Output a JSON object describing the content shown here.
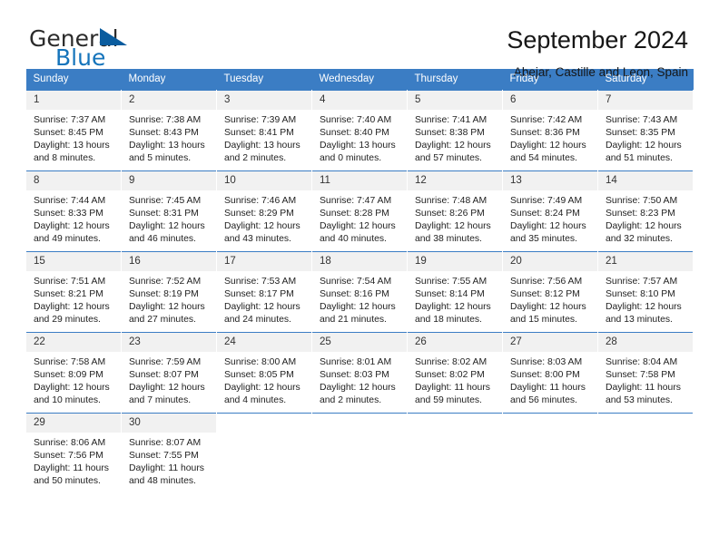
{
  "logo": {
    "word_one": "General",
    "word_two": "Blue",
    "triangle_icon": "triangle-icon"
  },
  "header": {
    "title": "September 2024",
    "subtitle": "Abejar, Castille and Leon, Spain"
  },
  "colors": {
    "header_blue": "#3b7dc4",
    "logo_blue": "#1574bb",
    "logo_triangle": "#0a5c9e",
    "daynum_band": "#f1f1f1",
    "text": "#222222"
  },
  "calendar": {
    "weekdays": [
      "Sunday",
      "Monday",
      "Tuesday",
      "Wednesday",
      "Thursday",
      "Friday",
      "Saturday"
    ],
    "labels": {
      "sunrise": "Sunrise:",
      "sunset": "Sunset:",
      "daylight": "Daylight:"
    },
    "weeks": [
      [
        {
          "day": "1",
          "sunrise": "Sunrise: 7:37 AM",
          "sunset": "Sunset: 8:45 PM",
          "daylight_1": "Daylight: 13 hours",
          "daylight_2": "and 8 minutes."
        },
        {
          "day": "2",
          "sunrise": "Sunrise: 7:38 AM",
          "sunset": "Sunset: 8:43 PM",
          "daylight_1": "Daylight: 13 hours",
          "daylight_2": "and 5 minutes."
        },
        {
          "day": "3",
          "sunrise": "Sunrise: 7:39 AM",
          "sunset": "Sunset: 8:41 PM",
          "daylight_1": "Daylight: 13 hours",
          "daylight_2": "and 2 minutes."
        },
        {
          "day": "4",
          "sunrise": "Sunrise: 7:40 AM",
          "sunset": "Sunset: 8:40 PM",
          "daylight_1": "Daylight: 13 hours",
          "daylight_2": "and 0 minutes."
        },
        {
          "day": "5",
          "sunrise": "Sunrise: 7:41 AM",
          "sunset": "Sunset: 8:38 PM",
          "daylight_1": "Daylight: 12 hours",
          "daylight_2": "and 57 minutes."
        },
        {
          "day": "6",
          "sunrise": "Sunrise: 7:42 AM",
          "sunset": "Sunset: 8:36 PM",
          "daylight_1": "Daylight: 12 hours",
          "daylight_2": "and 54 minutes."
        },
        {
          "day": "7",
          "sunrise": "Sunrise: 7:43 AM",
          "sunset": "Sunset: 8:35 PM",
          "daylight_1": "Daylight: 12 hours",
          "daylight_2": "and 51 minutes."
        }
      ],
      [
        {
          "day": "8",
          "sunrise": "Sunrise: 7:44 AM",
          "sunset": "Sunset: 8:33 PM",
          "daylight_1": "Daylight: 12 hours",
          "daylight_2": "and 49 minutes."
        },
        {
          "day": "9",
          "sunrise": "Sunrise: 7:45 AM",
          "sunset": "Sunset: 8:31 PM",
          "daylight_1": "Daylight: 12 hours",
          "daylight_2": "and 46 minutes."
        },
        {
          "day": "10",
          "sunrise": "Sunrise: 7:46 AM",
          "sunset": "Sunset: 8:29 PM",
          "daylight_1": "Daylight: 12 hours",
          "daylight_2": "and 43 minutes."
        },
        {
          "day": "11",
          "sunrise": "Sunrise: 7:47 AM",
          "sunset": "Sunset: 8:28 PM",
          "daylight_1": "Daylight: 12 hours",
          "daylight_2": "and 40 minutes."
        },
        {
          "day": "12",
          "sunrise": "Sunrise: 7:48 AM",
          "sunset": "Sunset: 8:26 PM",
          "daylight_1": "Daylight: 12 hours",
          "daylight_2": "and 38 minutes."
        },
        {
          "day": "13",
          "sunrise": "Sunrise: 7:49 AM",
          "sunset": "Sunset: 8:24 PM",
          "daylight_1": "Daylight: 12 hours",
          "daylight_2": "and 35 minutes."
        },
        {
          "day": "14",
          "sunrise": "Sunrise: 7:50 AM",
          "sunset": "Sunset: 8:23 PM",
          "daylight_1": "Daylight: 12 hours",
          "daylight_2": "and 32 minutes."
        }
      ],
      [
        {
          "day": "15",
          "sunrise": "Sunrise: 7:51 AM",
          "sunset": "Sunset: 8:21 PM",
          "daylight_1": "Daylight: 12 hours",
          "daylight_2": "and 29 minutes."
        },
        {
          "day": "16",
          "sunrise": "Sunrise: 7:52 AM",
          "sunset": "Sunset: 8:19 PM",
          "daylight_1": "Daylight: 12 hours",
          "daylight_2": "and 27 minutes."
        },
        {
          "day": "17",
          "sunrise": "Sunrise: 7:53 AM",
          "sunset": "Sunset: 8:17 PM",
          "daylight_1": "Daylight: 12 hours",
          "daylight_2": "and 24 minutes."
        },
        {
          "day": "18",
          "sunrise": "Sunrise: 7:54 AM",
          "sunset": "Sunset: 8:16 PM",
          "daylight_1": "Daylight: 12 hours",
          "daylight_2": "and 21 minutes."
        },
        {
          "day": "19",
          "sunrise": "Sunrise: 7:55 AM",
          "sunset": "Sunset: 8:14 PM",
          "daylight_1": "Daylight: 12 hours",
          "daylight_2": "and 18 minutes."
        },
        {
          "day": "20",
          "sunrise": "Sunrise: 7:56 AM",
          "sunset": "Sunset: 8:12 PM",
          "daylight_1": "Daylight: 12 hours",
          "daylight_2": "and 15 minutes."
        },
        {
          "day": "21",
          "sunrise": "Sunrise: 7:57 AM",
          "sunset": "Sunset: 8:10 PM",
          "daylight_1": "Daylight: 12 hours",
          "daylight_2": "and 13 minutes."
        }
      ],
      [
        {
          "day": "22",
          "sunrise": "Sunrise: 7:58 AM",
          "sunset": "Sunset: 8:09 PM",
          "daylight_1": "Daylight: 12 hours",
          "daylight_2": "and 10 minutes."
        },
        {
          "day": "23",
          "sunrise": "Sunrise: 7:59 AM",
          "sunset": "Sunset: 8:07 PM",
          "daylight_1": "Daylight: 12 hours",
          "daylight_2": "and 7 minutes."
        },
        {
          "day": "24",
          "sunrise": "Sunrise: 8:00 AM",
          "sunset": "Sunset: 8:05 PM",
          "daylight_1": "Daylight: 12 hours",
          "daylight_2": "and 4 minutes."
        },
        {
          "day": "25",
          "sunrise": "Sunrise: 8:01 AM",
          "sunset": "Sunset: 8:03 PM",
          "daylight_1": "Daylight: 12 hours",
          "daylight_2": "and 2 minutes."
        },
        {
          "day": "26",
          "sunrise": "Sunrise: 8:02 AM",
          "sunset": "Sunset: 8:02 PM",
          "daylight_1": "Daylight: 11 hours",
          "daylight_2": "and 59 minutes."
        },
        {
          "day": "27",
          "sunrise": "Sunrise: 8:03 AM",
          "sunset": "Sunset: 8:00 PM",
          "daylight_1": "Daylight: 11 hours",
          "daylight_2": "and 56 minutes."
        },
        {
          "day": "28",
          "sunrise": "Sunrise: 8:04 AM",
          "sunset": "Sunset: 7:58 PM",
          "daylight_1": "Daylight: 11 hours",
          "daylight_2": "and 53 minutes."
        }
      ],
      [
        {
          "day": "29",
          "sunrise": "Sunrise: 8:06 AM",
          "sunset": "Sunset: 7:56 PM",
          "daylight_1": "Daylight: 11 hours",
          "daylight_2": "and 50 minutes."
        },
        {
          "day": "30",
          "sunrise": "Sunrise: 8:07 AM",
          "sunset": "Sunset: 7:55 PM",
          "daylight_1": "Daylight: 11 hours",
          "daylight_2": "and 48 minutes."
        },
        {
          "day": "",
          "sunrise": "",
          "sunset": "",
          "daylight_1": "",
          "daylight_2": ""
        },
        {
          "day": "",
          "sunrise": "",
          "sunset": "",
          "daylight_1": "",
          "daylight_2": ""
        },
        {
          "day": "",
          "sunrise": "",
          "sunset": "",
          "daylight_1": "",
          "daylight_2": ""
        },
        {
          "day": "",
          "sunrise": "",
          "sunset": "",
          "daylight_1": "",
          "daylight_2": ""
        },
        {
          "day": "",
          "sunrise": "",
          "sunset": "",
          "daylight_1": "",
          "daylight_2": ""
        }
      ]
    ]
  }
}
